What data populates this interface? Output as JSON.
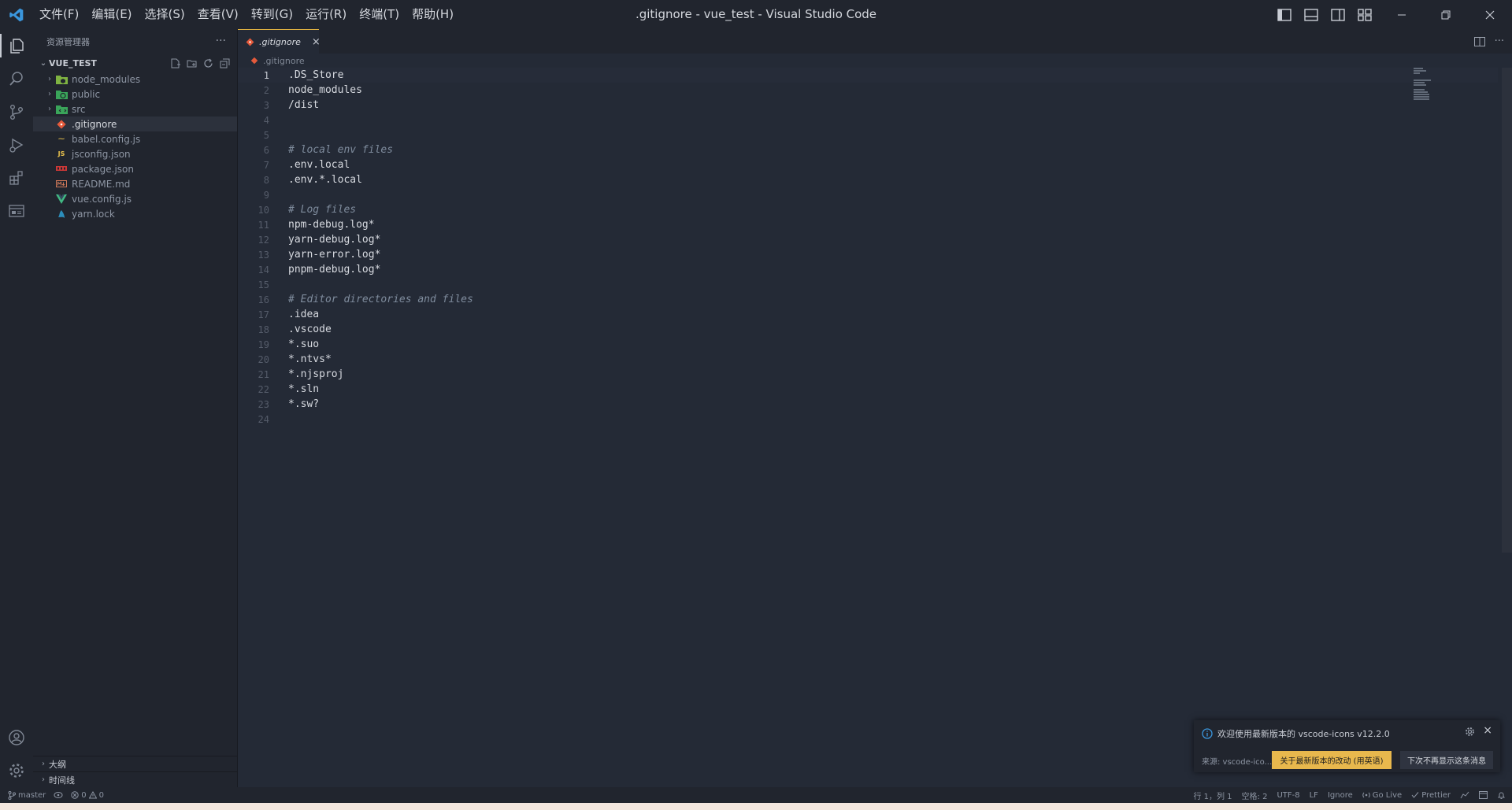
{
  "window": {
    "title": ".gitignore - vue_test - Visual Studio Code",
    "menu": [
      "文件(F)",
      "编辑(E)",
      "选择(S)",
      "查看(V)",
      "转到(G)",
      "运行(R)",
      "终端(T)",
      "帮助(H)"
    ]
  },
  "sidebar": {
    "title": "资源管理器",
    "more": "···",
    "folder": "VUE_TEST",
    "items": [
      {
        "name": "node_modules",
        "type": "folder"
      },
      {
        "name": "public",
        "type": "folder"
      },
      {
        "name": "src",
        "type": "folder"
      },
      {
        "name": ".gitignore",
        "type": "file",
        "selected": true
      },
      {
        "name": "babel.config.js",
        "type": "file"
      },
      {
        "name": "jsconfig.json",
        "type": "file"
      },
      {
        "name": "package.json",
        "type": "file"
      },
      {
        "name": "README.md",
        "type": "file"
      },
      {
        "name": "vue.config.js",
        "type": "file"
      },
      {
        "name": "yarn.lock",
        "type": "file"
      }
    ],
    "sections": [
      "大纲",
      "时间线"
    ]
  },
  "editor": {
    "tab": ".gitignore",
    "breadcrumb": ".gitignore",
    "current_line": 1,
    "lines": [
      ".DS_Store",
      "node_modules",
      "/dist",
      "",
      "",
      "# local env files",
      ".env.local",
      ".env.*.local",
      "",
      "# Log files",
      "npm-debug.log*",
      "yarn-debug.log*",
      "yarn-error.log*",
      "pnpm-debug.log*",
      "",
      "# Editor directories and files",
      ".idea",
      ".vscode",
      "*.suo",
      "*.ntvs*",
      "*.njsproj",
      "*.sln",
      "*.sw?",
      ""
    ]
  },
  "notification": {
    "message": "欢迎使用最新版本的 vscode-icons v12.2.0",
    "source": "来源: vscode-ico...",
    "primary_button": "关于最新版本的改动 (用英语)",
    "secondary_button": "下次不再显示这条消息"
  },
  "status": {
    "branch": "master",
    "errors": "0",
    "warnings": "0",
    "position": "行 1，列 1",
    "spaces": "空格: 2",
    "encoding": "UTF-8",
    "eol": "LF",
    "language": "Ignore",
    "golive": "Go Live",
    "prettier": "Prettier"
  },
  "colors": {
    "accent": "#e3b341",
    "vscode_blue": "#3a96dd",
    "notification_button": "#e8b84d"
  }
}
